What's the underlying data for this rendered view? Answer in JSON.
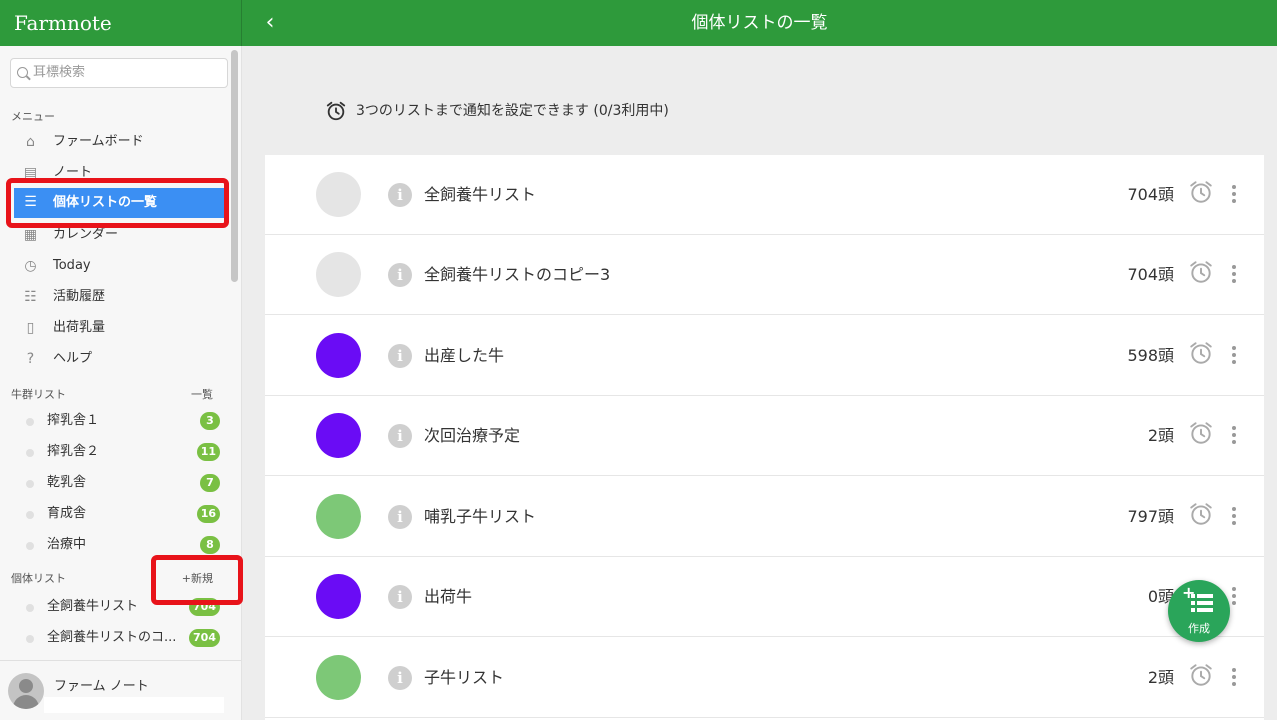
{
  "app": {
    "brand": "Farmnote",
    "title": "個体リストの一覧",
    "back_icon": "chevron-left-icon"
  },
  "search": {
    "placeholder": "耳標検索"
  },
  "sidebar": {
    "menu_header": "メニュー",
    "menu": [
      {
        "label": "ファームボード",
        "icon": "barn-icon"
      },
      {
        "label": "ノート",
        "icon": "note-icon"
      },
      {
        "label": "個体リストの一覧",
        "icon": "list-icon",
        "active": true
      },
      {
        "label": "カレンダー",
        "icon": "calendar-icon"
      },
      {
        "label": "Today",
        "icon": "clock-icon"
      },
      {
        "label": "活動履歴",
        "icon": "history-icon"
      },
      {
        "label": "出荷乳量",
        "icon": "milk-bottle-icon"
      },
      {
        "label": "ヘルプ",
        "icon": "help-icon"
      }
    ],
    "herd_header": "牛群リスト",
    "herd_all": "一覧",
    "herds": [
      {
        "label": "搾乳舎１",
        "count": "3"
      },
      {
        "label": "搾乳舎２",
        "count": "11"
      },
      {
        "label": "乾乳舎",
        "count": "7"
      },
      {
        "label": "育成舎",
        "count": "16"
      },
      {
        "label": "治療中",
        "count": "8"
      }
    ],
    "indiv_header": "個体リスト",
    "indiv_new": "+新規",
    "indiv": [
      {
        "label": "全飼養牛リスト",
        "count": "704"
      },
      {
        "label": "全飼養牛リストのコ...",
        "count": "704"
      }
    ],
    "user_name": "ファーム ノート"
  },
  "notice": {
    "text": "3つのリストまで通知を設定できます (0/3利用中)",
    "icon": "alarm-clock-icon"
  },
  "lists": [
    {
      "name": "全飼養牛リスト",
      "count": "704頭",
      "color": "#e5e5e5"
    },
    {
      "name": "全飼養牛リストのコピー3",
      "count": "704頭",
      "color": "#e5e5e5"
    },
    {
      "name": "出産した牛",
      "count": "598頭",
      "color": "#6a0cf5"
    },
    {
      "name": "次回治療予定",
      "count": "2頭",
      "color": "#6a0cf5"
    },
    {
      "name": "哺乳子牛リスト",
      "count": "797頭",
      "color": "#7dc877"
    },
    {
      "name": "出荷牛",
      "count": "0頭",
      "color": "#6a0cf5"
    },
    {
      "name": "子牛リスト",
      "count": "2頭",
      "color": "#7dc877"
    }
  ],
  "fab": {
    "label": "作成",
    "icon": "add-list-icon",
    "color": "#2aa55a"
  },
  "colors": {
    "brand": "#2e9a3b",
    "active": "#3b8ff3",
    "badge": "#7ac043",
    "highlight": "#e8131a"
  }
}
